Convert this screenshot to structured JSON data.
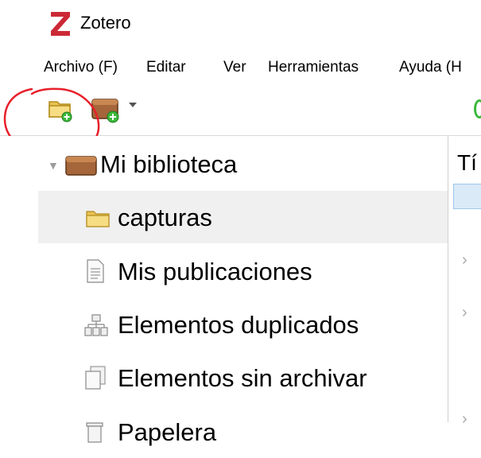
{
  "app": {
    "title": "Zotero",
    "logo_color": "#cc2936"
  },
  "menu": [
    {
      "label": "Archivo (F)"
    },
    {
      "label": "Editar"
    },
    {
      "label": "Ver"
    },
    {
      "label": "Herramientas"
    },
    {
      "label": "Ayuda (H"
    }
  ],
  "toolbar": {
    "new_collection_icon": "new-collection-icon",
    "new_library_icon": "new-library-icon"
  },
  "collections": {
    "library": {
      "label": "Mi biblioteca",
      "expanded": true
    },
    "items": [
      {
        "label": "capturas",
        "icon": "folder-icon",
        "selected": true
      },
      {
        "label": "Mis publicaciones",
        "icon": "document-icon"
      },
      {
        "label": "Elementos duplicados",
        "icon": "duplicates-icon"
      },
      {
        "label": "Elementos sin archivar",
        "icon": "unfiled-icon"
      },
      {
        "label": "Papelera",
        "icon": "trash-icon"
      }
    ]
  },
  "items_pane": {
    "column_header": "Tí"
  },
  "colors": {
    "selected_row": "#f0f0f0",
    "annotation": "#e8202a",
    "accent_green": "#3cb93c"
  }
}
